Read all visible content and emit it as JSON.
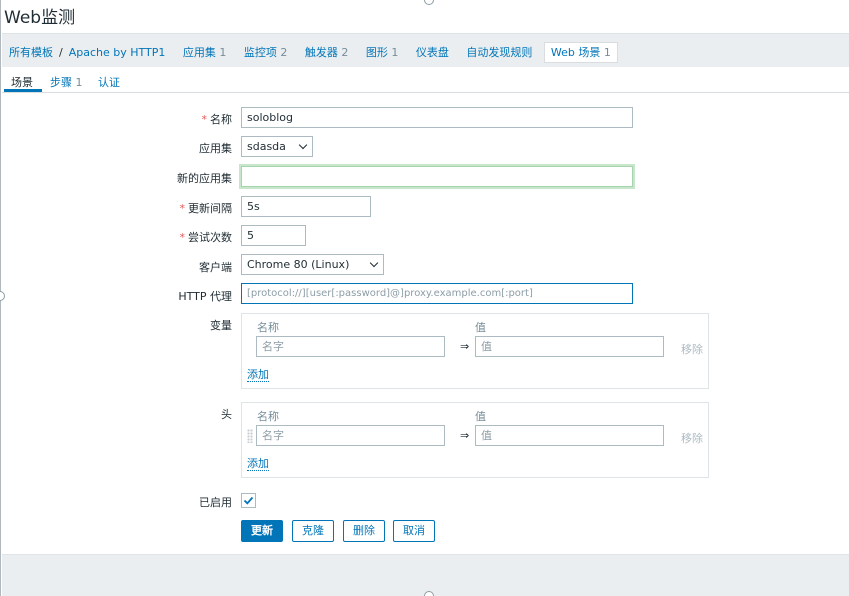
{
  "title": "Web监测",
  "breadcrumb": {
    "all_templates": "所有模板",
    "separator": "/",
    "template": "Apache by HTTP1",
    "applications": "应用集",
    "applications_count": "1",
    "items": "监控项",
    "items_count": "2",
    "triggers": "触发器",
    "triggers_count": "2",
    "graphs": "图形",
    "graphs_count": "1",
    "dashboards": "仪表盘",
    "discovery": "自动发现规则",
    "web": "Web 场景",
    "web_count": "1"
  },
  "tabs": {
    "scenario": "场景",
    "steps": "步骤",
    "steps_count": "1",
    "auth": "认证"
  },
  "form": {
    "required_mark": "*",
    "name_label": "名称",
    "name_value": "soloblog",
    "app_label": "应用集",
    "app_value": "sdasda",
    "new_app_label": "新的应用集",
    "new_app_value": "",
    "interval_label": "更新间隔",
    "interval_value": "5s",
    "attempts_label": "尝试次数",
    "attempts_value": "5",
    "agent_label": "客户端",
    "agent_value": "Chrome 80 (Linux)",
    "proxy_label": "HTTP 代理",
    "proxy_placeholder": "[protocol://][user[:password]@]proxy.example.com[:port]",
    "variables_label": "变量",
    "headers_label": "头",
    "col_name": "名称",
    "col_value": "值",
    "name_placeholder": "名字",
    "value_placeholder": "值",
    "arrow": "⇒",
    "remove": "移除",
    "add": "添加",
    "enabled_label": "已启用",
    "enabled": true
  },
  "buttons": {
    "update": "更新",
    "clone": "克隆",
    "delete": "删除",
    "cancel": "取消"
  },
  "colors": {
    "accent": "#0275b8",
    "required": "#e45959",
    "background": "#ebeef0"
  }
}
